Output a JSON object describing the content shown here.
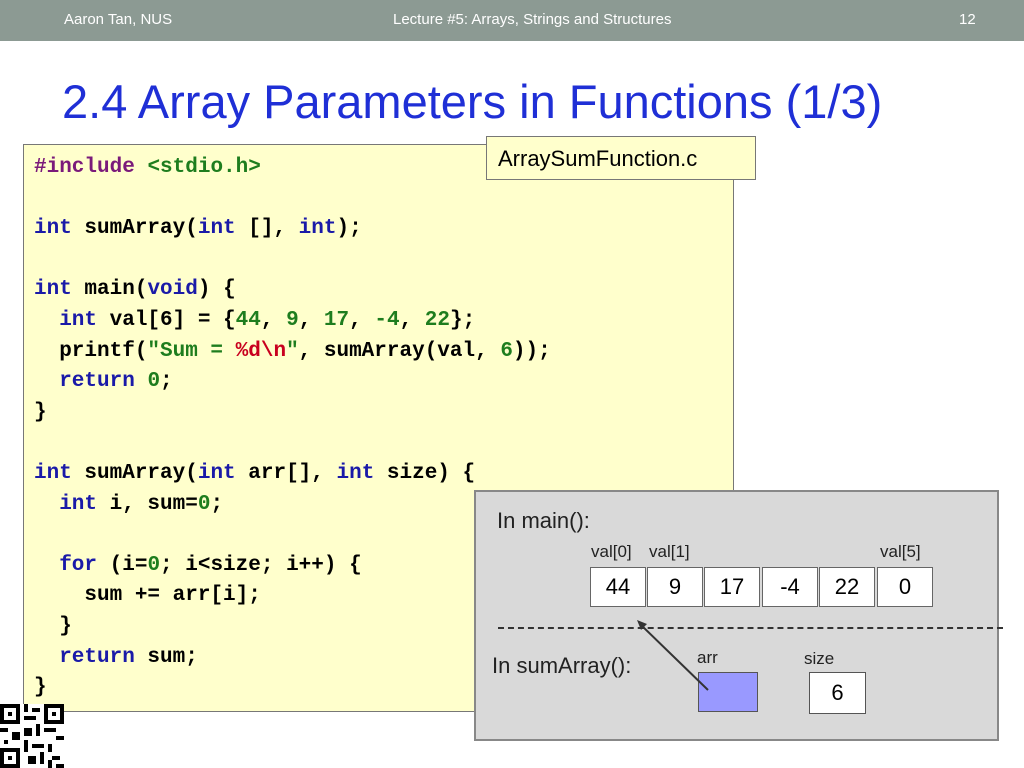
{
  "header": {
    "author": "Aaron Tan, NUS",
    "lecture": "Lecture #5: Arrays, Strings and Structures",
    "page": "12"
  },
  "title": "2.4 Array Parameters in Functions (1/3)",
  "filename": "ArraySumFunction.c",
  "code": {
    "l1_a": "#include",
    "l1_b": "<stdio.h>",
    "l3_a": "int",
    "l3_b": " sumArray(",
    "l3_c": "int",
    "l3_d": " [], ",
    "l3_e": "int",
    "l3_f": ");",
    "l5_a": "int",
    "l5_b": " main(",
    "l5_c": "void",
    "l5_d": ") {",
    "l6_a": "  int",
    "l6_b": " val[6] = {",
    "l6_c": "44",
    "l6_d": ", ",
    "l6_e": "9",
    "l6_f": ", ",
    "l6_g": "17",
    "l6_h": ", ",
    "l6_i": "-4",
    "l6_j": ", ",
    "l6_k": "22",
    "l6_l": "};",
    "l7_a": "  printf(",
    "l7_b": "\"Sum = ",
    "l7_c": "%d\\n",
    "l7_d": "\"",
    "l7_e": ", sumArray(val, ",
    "l7_f": "6",
    "l7_g": "));",
    "l8_a": "  return",
    "l8_b": " ",
    "l8_c": "0",
    "l8_d": ";",
    "l9_a": "}",
    "l11_a": "int",
    "l11_b": " sumArray(",
    "l11_c": "int",
    "l11_d": " arr[], ",
    "l11_e": "int",
    "l11_f": " size) {",
    "l12_a": "  int",
    "l12_b": " i, sum=",
    "l12_c": "0",
    "l12_d": ";",
    "l14_a": "  for",
    "l14_b": " (i=",
    "l14_c": "0",
    "l14_d": "; i<size; i++) {",
    "l15_a": "    sum += arr[i];",
    "l16_a": "  }",
    "l17_a": "  return",
    "l17_b": " sum;",
    "l18_a": "}"
  },
  "diagram": {
    "main_label": "In main():",
    "sum_label": "In sumArray():",
    "index_labels": [
      "val[0]",
      "val[1]",
      "val[5]"
    ],
    "values": [
      "44",
      "9",
      "17",
      "-4",
      "22",
      "0"
    ],
    "arr_label": "arr",
    "size_label": "size",
    "size_value": "6",
    "colors": {
      "arr_box": "#9999ff",
      "background": "#d9d9d9"
    }
  }
}
